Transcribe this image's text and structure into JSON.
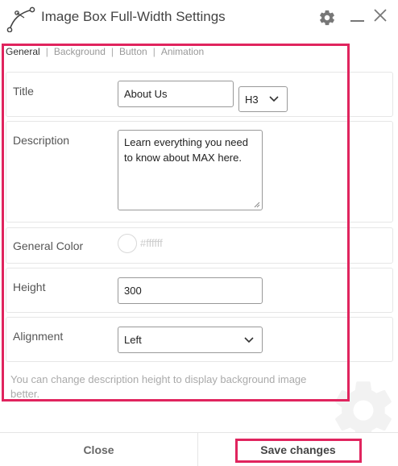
{
  "header": {
    "title": "Image Box Full-Width Settings",
    "icons": {
      "logo": "curve-pen-icon",
      "settings": "gear-icon",
      "minimize": "minimize-icon",
      "close": "close-icon"
    }
  },
  "tabs": [
    {
      "label": "General",
      "active": true
    },
    {
      "label": "Background",
      "active": false
    },
    {
      "label": "Button",
      "active": false
    },
    {
      "label": "Animation",
      "active": false
    }
  ],
  "tab_separator": "|",
  "fields": {
    "title": {
      "label": "Title",
      "value": "About Us",
      "heading_level": "H3"
    },
    "description": {
      "label": "Description",
      "value": "Learn everything you need to know about MAX here."
    },
    "general_color": {
      "label": "General Color",
      "value": "#ffffff"
    },
    "height": {
      "label": "Height",
      "value": "300"
    },
    "alignment": {
      "label": "Alignment",
      "value": "Left"
    }
  },
  "note": "You can change description height to display background image better.",
  "footer": {
    "close_label": "Close",
    "save_label": "Save changes"
  },
  "colors": {
    "highlight": "#e0245e",
    "border": "#e6e6e6",
    "muted_text": "#aaaaaa"
  }
}
